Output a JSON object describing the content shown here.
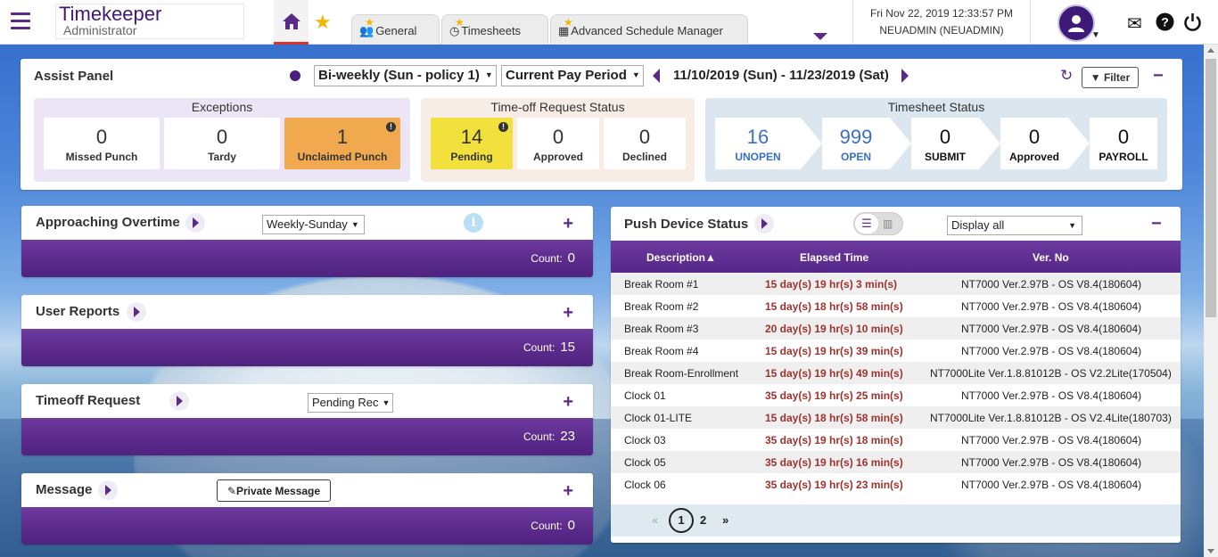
{
  "header": {
    "app_title": "Timekeeper",
    "role": "Administrator",
    "tabs": [
      {
        "label": "General",
        "icon": "users-icon"
      },
      {
        "label": "Timesheets",
        "icon": "clock-icon"
      },
      {
        "label": "Advanced Schedule Manager",
        "icon": "calendar-icon"
      }
    ],
    "datetime": "Fri Nov 22, 2019 12:33:57 PM",
    "user": "NEUADMIN (NEUADMIN)"
  },
  "assist": {
    "title": "Assist Panel",
    "policy": "Bi-weekly (Sun - policy 1)",
    "period": "Current Pay Period",
    "range": "11/10/2019 (Sun) - 11/23/2019 (Sat)",
    "filter_label": "Filter",
    "exceptions": {
      "title": "Exceptions",
      "items": [
        {
          "value": "0",
          "label": "Missed Punch"
        },
        {
          "value": "0",
          "label": "Tardy"
        },
        {
          "value": "1",
          "label": "Unclaimed Punch"
        }
      ]
    },
    "timeoff": {
      "title": "Time-off Request Status",
      "items": [
        {
          "value": "14",
          "label": "Pending"
        },
        {
          "value": "0",
          "label": "Approved"
        },
        {
          "value": "0",
          "label": "Declined"
        }
      ]
    },
    "timesheet": {
      "title": "Timesheet Status",
      "items": [
        {
          "value": "16",
          "label": "UNOPEN"
        },
        {
          "value": "999",
          "label": "OPEN"
        },
        {
          "value": "0",
          "label": "SUBMIT"
        },
        {
          "value": "0",
          "label": "Approved"
        },
        {
          "value": "0",
          "label": "PAYROLL"
        }
      ]
    }
  },
  "widgets": {
    "overtime": {
      "title": "Approaching Overtime",
      "select": "Weekly-Sunday",
      "count_label": "Count:",
      "count": "0"
    },
    "reports": {
      "title": "User Reports",
      "count_label": "Count:",
      "count": "15"
    },
    "timeoff": {
      "title": "Timeoff Request",
      "select": "Pending Rec",
      "count_label": "Count:",
      "count": "23"
    },
    "message": {
      "title": "Message",
      "button": "Private Message",
      "count_label": "Count:",
      "count": "0"
    }
  },
  "push": {
    "title": "Push Device Status",
    "filter": "Display all",
    "columns": [
      "Description",
      "Elapsed Time",
      "Ver. No"
    ],
    "rows": [
      {
        "desc": "Break Room #1",
        "elapsed": "15 day(s) 19 hr(s) 3 min(s)",
        "ver": "NT7000 Ver.2.97B - OS V8.4(180604)"
      },
      {
        "desc": "Break Room #2",
        "elapsed": "15 day(s) 18 hr(s) 58 min(s)",
        "ver": "NT7000 Ver.2.97B - OS V8.4(180604)"
      },
      {
        "desc": "Break Room #3",
        "elapsed": "20 day(s) 19 hr(s) 10 min(s)",
        "ver": "NT7000 Ver.2.97B - OS V8.4(180604)"
      },
      {
        "desc": "Break Room #4",
        "elapsed": "15 day(s) 19 hr(s) 39 min(s)",
        "ver": "NT7000 Ver.2.97B - OS V8.4(180604)"
      },
      {
        "desc": "Break Room-Enrollment",
        "elapsed": "15 day(s) 19 hr(s) 49 min(s)",
        "ver": "NT7000Lite Ver.1.8.81012B - OS V2.2Lite(170504)"
      },
      {
        "desc": "Clock 01",
        "elapsed": "35 day(s) 19 hr(s) 25 min(s)",
        "ver": "NT7000 Ver.2.97B - OS V8.4(180604)"
      },
      {
        "desc": "Clock 01-LITE",
        "elapsed": "15 day(s) 18 hr(s) 58 min(s)",
        "ver": "NT7000Lite Ver.1.8.81012B - OS V2.4Lite(180703)"
      },
      {
        "desc": "Clock 03",
        "elapsed": "35 day(s) 19 hr(s) 18 min(s)",
        "ver": "NT7000 Ver.2.97B - OS V8.4(180604)"
      },
      {
        "desc": "Clock 05",
        "elapsed": "35 day(s) 19 hr(s) 16 min(s)",
        "ver": "NT7000 Ver.2.97B - OS V8.4(180604)"
      },
      {
        "desc": "Clock 06",
        "elapsed": "35 day(s) 19 hr(s) 23 min(s)",
        "ver": "NT7000 Ver.2.97B - OS V8.4(180604)"
      }
    ],
    "pager": {
      "prev": "«",
      "current": "1",
      "next_page": "2",
      "next": "»"
    }
  },
  "colors": {
    "brand": "#5b2a86",
    "pending": "#f2e13c",
    "unclaimed": "#f0a94f",
    "elapsed": "#a0322e",
    "link": "#3a6fc8"
  }
}
